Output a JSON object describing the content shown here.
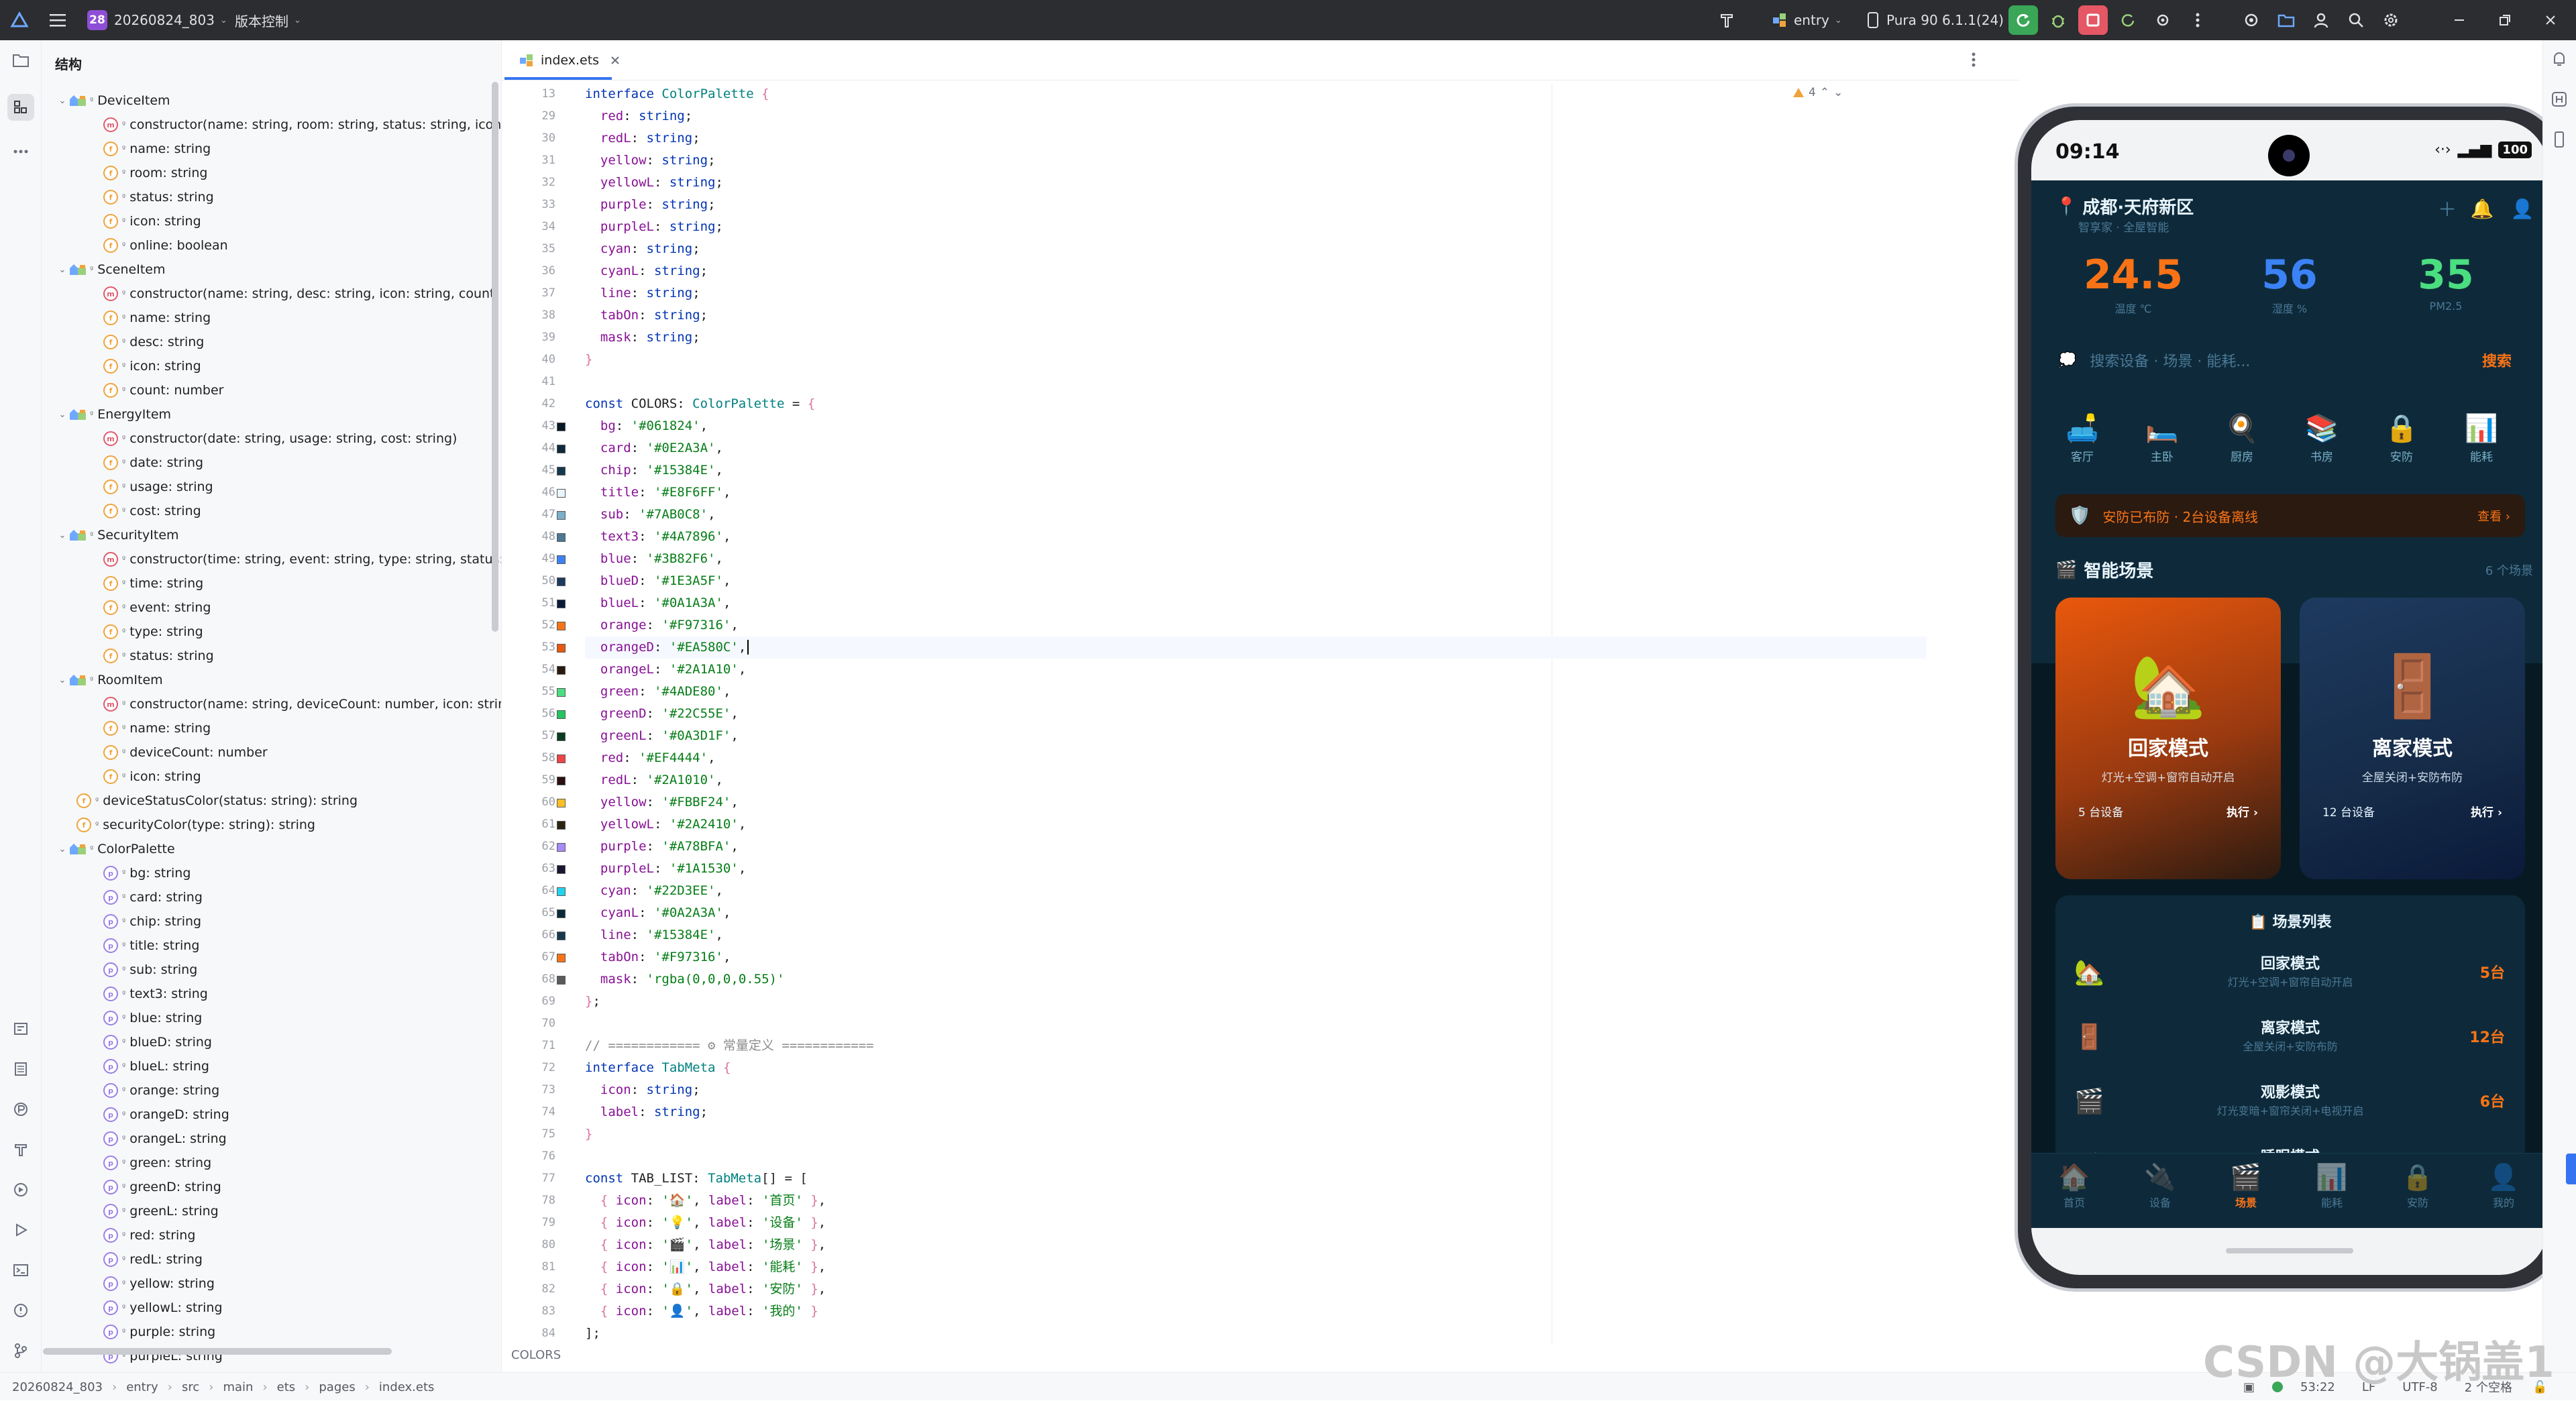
{
  "titlebar": {
    "project_badge": "28",
    "project_name": "20260824_803",
    "vcs": "版本控制",
    "run_config": "entry",
    "device": "Pura 90 6.1.1(24)"
  },
  "structure": {
    "title": "结构",
    "items": [
      {
        "kind": "class",
        "label": "DeviceItem",
        "indent": 0
      },
      {
        "kind": "method",
        "label": "constructor(name: string, room: string, status: string, icon: string, online: boolean)",
        "indent": 1
      },
      {
        "kind": "field",
        "label": "name: string",
        "indent": 1
      },
      {
        "kind": "field",
        "label": "room: string",
        "indent": 1
      },
      {
        "kind": "field",
        "label": "status: string",
        "indent": 1
      },
      {
        "kind": "field",
        "label": "icon: string",
        "indent": 1
      },
      {
        "kind": "field",
        "label": "online: boolean",
        "indent": 1
      },
      {
        "kind": "class",
        "label": "SceneItem",
        "indent": 0
      },
      {
        "kind": "method",
        "label": "constructor(name: string, desc: string, icon: string, count: number)",
        "indent": 1
      },
      {
        "kind": "field",
        "label": "name: string",
        "indent": 1
      },
      {
        "kind": "field",
        "label": "desc: string",
        "indent": 1
      },
      {
        "kind": "field",
        "label": "icon: string",
        "indent": 1
      },
      {
        "kind": "field",
        "label": "count: number",
        "indent": 1
      },
      {
        "kind": "class",
        "label": "EnergyItem",
        "indent": 0
      },
      {
        "kind": "method",
        "label": "constructor(date: string, usage: string, cost: string)",
        "indent": 1
      },
      {
        "kind": "field",
        "label": "date: string",
        "indent": 1
      },
      {
        "kind": "field",
        "label": "usage: string",
        "indent": 1
      },
      {
        "kind": "field",
        "label": "cost: string",
        "indent": 1
      },
      {
        "kind": "class",
        "label": "SecurityItem",
        "indent": 0
      },
      {
        "kind": "method",
        "label": "constructor(time: string, event: string, type: string, status: string)",
        "indent": 1
      },
      {
        "kind": "field",
        "label": "time: string",
        "indent": 1
      },
      {
        "kind": "field",
        "label": "event: string",
        "indent": 1
      },
      {
        "kind": "field",
        "label": "type: string",
        "indent": 1
      },
      {
        "kind": "field",
        "label": "status: string",
        "indent": 1
      },
      {
        "kind": "class",
        "label": "RoomItem",
        "indent": 0
      },
      {
        "kind": "method",
        "label": "constructor(name: string, deviceCount: number, icon: string)",
        "indent": 1
      },
      {
        "kind": "field",
        "label": "name: string",
        "indent": 1
      },
      {
        "kind": "field",
        "label": "deviceCount: number",
        "indent": 1
      },
      {
        "kind": "field",
        "label": "icon: string",
        "indent": 1
      },
      {
        "kind": "func",
        "label": "deviceStatusColor(status: string): string",
        "indent": 0
      },
      {
        "kind": "func",
        "label": "securityColor(type: string): string",
        "indent": 0
      },
      {
        "kind": "iface",
        "label": "ColorPalette",
        "indent": 0
      },
      {
        "kind": "prop",
        "label": "bg: string",
        "indent": 1
      },
      {
        "kind": "prop",
        "label": "card: string",
        "indent": 1
      },
      {
        "kind": "prop",
        "label": "chip: string",
        "indent": 1
      },
      {
        "kind": "prop",
        "label": "title: string",
        "indent": 1
      },
      {
        "kind": "prop",
        "label": "sub: string",
        "indent": 1
      },
      {
        "kind": "prop",
        "label": "text3: string",
        "indent": 1
      },
      {
        "kind": "prop",
        "label": "blue: string",
        "indent": 1
      },
      {
        "kind": "prop",
        "label": "blueD: string",
        "indent": 1
      },
      {
        "kind": "prop",
        "label": "blueL: string",
        "indent": 1
      },
      {
        "kind": "prop",
        "label": "orange: string",
        "indent": 1
      },
      {
        "kind": "prop",
        "label": "orangeD: string",
        "indent": 1
      },
      {
        "kind": "prop",
        "label": "orangeL: string",
        "indent": 1
      },
      {
        "kind": "prop",
        "label": "green: string",
        "indent": 1
      },
      {
        "kind": "prop",
        "label": "greenD: string",
        "indent": 1
      },
      {
        "kind": "prop",
        "label": "greenL: string",
        "indent": 1
      },
      {
        "kind": "prop",
        "label": "red: string",
        "indent": 1
      },
      {
        "kind": "prop",
        "label": "redL: string",
        "indent": 1
      },
      {
        "kind": "prop",
        "label": "yellow: string",
        "indent": 1
      },
      {
        "kind": "prop",
        "label": "yellowL: string",
        "indent": 1
      },
      {
        "kind": "prop",
        "label": "purple: string",
        "indent": 1
      },
      {
        "kind": "prop",
        "label": "purpleL: string",
        "indent": 1
      }
    ]
  },
  "editor": {
    "tab_name": "index.ets",
    "warning_count": "4",
    "context_label": "COLORS",
    "lines": [
      {
        "n": "13",
        "html": "<span class='kw'>interface</span> <span class='ty'>ColorPalette</span> <span class='br'>{</span>",
        "sw": ""
      },
      {
        "n": "29",
        "html": "  <span class='pr'>red</span>: <span class='kw'>string</span>;",
        "sw": ""
      },
      {
        "n": "30",
        "html": "  <span class='pr'>redL</span>: <span class='kw'>string</span>;",
        "sw": ""
      },
      {
        "n": "31",
        "html": "  <span class='pr'>yellow</span>: <span class='kw'>string</span>;",
        "sw": ""
      },
      {
        "n": "32",
        "html": "  <span class='pr'>yellowL</span>: <span class='kw'>string</span>;",
        "sw": ""
      },
      {
        "n": "33",
        "html": "  <span class='pr'>purple</span>: <span class='kw'>string</span>;",
        "sw": ""
      },
      {
        "n": "34",
        "html": "  <span class='pr'>purpleL</span>: <span class='kw'>string</span>;",
        "sw": ""
      },
      {
        "n": "35",
        "html": "  <span class='pr'>cyan</span>: <span class='kw'>string</span>;",
        "sw": ""
      },
      {
        "n": "36",
        "html": "  <span class='pr'>cyanL</span>: <span class='kw'>string</span>;",
        "sw": ""
      },
      {
        "n": "37",
        "html": "  <span class='pr'>line</span>: <span class='kw'>string</span>;",
        "sw": ""
      },
      {
        "n": "38",
        "html": "  <span class='pr'>tabOn</span>: <span class='kw'>string</span>;",
        "sw": ""
      },
      {
        "n": "39",
        "html": "  <span class='pr'>mask</span>: <span class='kw'>string</span>;",
        "sw": ""
      },
      {
        "n": "40",
        "html": "<span class='br'>}</span>",
        "sw": ""
      },
      {
        "n": "41",
        "html": "",
        "sw": ""
      },
      {
        "n": "42",
        "html": "<span class='kw'>const</span> COLORS: <span class='ty'>ColorPalette</span> = <span class='br'>{</span>",
        "sw": ""
      },
      {
        "n": "43",
        "html": "  <span class='pr'>bg</span>: <span class='st'>'#061824'</span>,",
        "sw": "#061824"
      },
      {
        "n": "44",
        "html": "  <span class='pr'>card</span>: <span class='st'>'#0E2A3A'</span>,",
        "sw": "#0E2A3A"
      },
      {
        "n": "45",
        "html": "  <span class='pr'>chip</span>: <span class='st'>'#15384E'</span>,",
        "sw": "#15384E"
      },
      {
        "n": "46",
        "html": "  <span class='pr'>title</span>: <span class='st'>'#E8F6FF'</span>,",
        "sw": "#E8F6FF"
      },
      {
        "n": "47",
        "html": "  <span class='pr'>sub</span>: <span class='st'>'#7AB0C8'</span>,",
        "sw": "#7AB0C8"
      },
      {
        "n": "48",
        "html": "  <span class='pr'>text3</span>: <span class='st'>'#4A7896'</span>,",
        "sw": "#4A7896"
      },
      {
        "n": "49",
        "html": "  <span class='pr'>blue</span>: <span class='st'>'#3B82F6'</span>,",
        "sw": "#3B82F6"
      },
      {
        "n": "50",
        "html": "  <span class='pr'>blueD</span>: <span class='st'>'#1E3A5F'</span>,",
        "sw": "#1E3A5F"
      },
      {
        "n": "51",
        "html": "  <span class='pr'>blueL</span>: <span class='st'>'#0A1A3A'</span>,",
        "sw": "#0A1A3A"
      },
      {
        "n": "52",
        "html": "  <span class='pr'>orange</span>: <span class='st'>'#F97316'</span>,",
        "sw": "#F97316"
      },
      {
        "n": "53",
        "html": "  <span class='pr'>orangeD</span>: <span class='st'>'#EA580C'</span>,",
        "sw": "#EA580C",
        "cur": true
      },
      {
        "n": "54",
        "html": "  <span class='pr'>orangeL</span>: <span class='st'>'#2A1A10'</span>,",
        "sw": "#2A1A10"
      },
      {
        "n": "55",
        "html": "  <span class='pr'>green</span>: <span class='st'>'#4ADE80'</span>,",
        "sw": "#4ADE80"
      },
      {
        "n": "56",
        "html": "  <span class='pr'>greenD</span>: <span class='st'>'#22C55E'</span>,",
        "sw": "#22C55E"
      },
      {
        "n": "57",
        "html": "  <span class='pr'>greenL</span>: <span class='st'>'#0A3D1F'</span>,",
        "sw": "#0A3D1F"
      },
      {
        "n": "58",
        "html": "  <span class='pr'>red</span>: <span class='st'>'#EF4444'</span>,",
        "sw": "#EF4444"
      },
      {
        "n": "59",
        "html": "  <span class='pr'>redL</span>: <span class='st'>'#2A1010'</span>,",
        "sw": "#2A1010"
      },
      {
        "n": "60",
        "html": "  <span class='pr'>yellow</span>: <span class='st'>'#FBBF24'</span>,",
        "sw": "#FBBF24"
      },
      {
        "n": "61",
        "html": "  <span class='pr'>yellowL</span>: <span class='st'>'#2A2410'</span>,",
        "sw": "#2A2410"
      },
      {
        "n": "62",
        "html": "  <span class='pr'>purple</span>: <span class='st'>'#A78BFA'</span>,",
        "sw": "#A78BFA"
      },
      {
        "n": "63",
        "html": "  <span class='pr'>purpleL</span>: <span class='st'>'#1A1530'</span>,",
        "sw": "#1A1530"
      },
      {
        "n": "64",
        "html": "  <span class='pr'>cyan</span>: <span class='st'>'#22D3EE'</span>,",
        "sw": "#22D3EE"
      },
      {
        "n": "65",
        "html": "  <span class='pr'>cyanL</span>: <span class='st'>'#0A2A3A'</span>,",
        "sw": "#0A2A3A"
      },
      {
        "n": "66",
        "html": "  <span class='pr'>line</span>: <span class='st'>'#15384E'</span>,",
        "sw": "#15384E"
      },
      {
        "n": "67",
        "html": "  <span class='pr'>tabOn</span>: <span class='st'>'#F97316'</span>,",
        "sw": "#F97316"
      },
      {
        "n": "68",
        "html": "  <span class='pr'>mask</span>: <span class='st'>'rgba(0,0,0,0.55)'</span>",
        "sw": "#5A5A5A"
      },
      {
        "n": "69",
        "html": "<span class='br'>}</span>;",
        "sw": ""
      },
      {
        "n": "70",
        "html": "",
        "sw": ""
      },
      {
        "n": "71",
        "html": "<span class='cm'>// ============ ⚙ 常量定义 ============</span>",
        "sw": ""
      },
      {
        "n": "72",
        "html": "<span class='kw'>interface</span> <span class='ty'>TabMeta</span> <span class='br'>{</span>",
        "sw": ""
      },
      {
        "n": "73",
        "html": "  <span class='pr'>icon</span>: <span class='kw'>string</span>;",
        "sw": ""
      },
      {
        "n": "74",
        "html": "  <span class='pr'>label</span>: <span class='kw'>string</span>;",
        "sw": ""
      },
      {
        "n": "75",
        "html": "<span class='br'>}</span>",
        "sw": ""
      },
      {
        "n": "76",
        "html": "",
        "sw": ""
      },
      {
        "n": "77",
        "html": "<span class='kw'>const</span> TAB_LIST: <span class='ty'>TabMeta</span>[] = [",
        "sw": ""
      },
      {
        "n": "78",
        "html": "  <span class='br'>{</span> <span class='pr'>icon</span>: <span class='st'>'🏠'</span>, <span class='pr'>label</span>: <span class='st'>'首页'</span> <span class='br'>}</span>,",
        "sw": ""
      },
      {
        "n": "79",
        "html": "  <span class='br'>{</span> <span class='pr'>icon</span>: <span class='st'>'💡'</span>, <span class='pr'>label</span>: <span class='st'>'设备'</span> <span class='br'>}</span>,",
        "sw": ""
      },
      {
        "n": "80",
        "html": "  <span class='br'>{</span> <span class='pr'>icon</span>: <span class='st'>'🎬'</span>, <span class='pr'>label</span>: <span class='st'>'场景'</span> <span class='br'>}</span>,",
        "sw": ""
      },
      {
        "n": "81",
        "html": "  <span class='br'>{</span> <span class='pr'>icon</span>: <span class='st'>'📊'</span>, <span class='pr'>label</span>: <span class='st'>'能耗'</span> <span class='br'>}</span>,",
        "sw": ""
      },
      {
        "n": "82",
        "html": "  <span class='br'>{</span> <span class='pr'>icon</span>: <span class='st'>'🔒'</span>, <span class='pr'>label</span>: <span class='st'>'安防'</span> <span class='br'>}</span>,",
        "sw": ""
      },
      {
        "n": "83",
        "html": "  <span class='br'>{</span> <span class='pr'>icon</span>: <span class='st'>'👤'</span>, <span class='pr'>label</span>: <span class='st'>'我的'</span> <span class='br'>}</span>",
        "sw": ""
      },
      {
        "n": "84",
        "html": "];",
        "sw": ""
      }
    ]
  },
  "statusbar": {
    "crumbs": [
      "20260824_803",
      "entry",
      "src",
      "main",
      "ets",
      "pages",
      "index.ets"
    ],
    "position": "53:22",
    "line_sep": "LF",
    "encoding": "UTF-8",
    "indent": "2 个空格"
  },
  "phone": {
    "time": "09:14",
    "battery": "100",
    "location": "成都·天府新区",
    "location_sub": "智享家 · 全屋智能",
    "stats": [
      {
        "value": "24.5",
        "label": "温度 ℃",
        "color": "#F97316"
      },
      {
        "value": "56",
        "label": "湿度 %",
        "color": "#3B82F6"
      },
      {
        "value": "35",
        "label": "PM2.5",
        "color": "#4ADE80"
      }
    ],
    "search_placeholder": "搜索设备 · 场景 · 能耗...",
    "search_button": "搜索",
    "rooms": [
      {
        "icon": "🛋️",
        "label": "客厅"
      },
      {
        "icon": "🛏️",
        "label": "主卧"
      },
      {
        "icon": "🍳",
        "label": "厨房"
      },
      {
        "icon": "📚",
        "label": "书房"
      },
      {
        "icon": "🔒",
        "label": "安防"
      },
      {
        "icon": "📊",
        "label": "能耗"
      }
    ],
    "alert_text": "安防已布防 · 2台设备离线",
    "alert_more": "查看 ›",
    "section_title": "智能场景",
    "section_count": "6 个场景",
    "cards": [
      {
        "icon": "🏡",
        "title": "回家模式",
        "desc": "灯光+空调+窗帘自动开启",
        "count": "5 台设备",
        "action": "执行 ›"
      },
      {
        "icon": "🚪",
        "title": "离家模式",
        "desc": "全屋关闭+安防布防",
        "count": "12 台设备",
        "action": "执行 ›"
      }
    ],
    "list_title": "📋 场景列表",
    "list": [
      {
        "icon": "🏡",
        "title": "回家模式",
        "desc": "灯光+空调+窗帘自动开启",
        "count": "5台"
      },
      {
        "icon": "🚪",
        "title": "离家模式",
        "desc": "全屋关闭+安防布防",
        "count": "12台"
      },
      {
        "icon": "🎬",
        "title": "观影模式",
        "desc": "灯光变暗+窗帘关闭+电视开启",
        "count": "6台"
      },
      {
        "icon": "🌙",
        "title": "睡眠模式",
        "desc": "",
        "count": ""
      }
    ],
    "tabs": [
      {
        "icon": "🏠",
        "label": "首页"
      },
      {
        "icon": "🔌",
        "label": "设备"
      },
      {
        "icon": "🎬",
        "label": "场景"
      },
      {
        "icon": "📊",
        "label": "能耗"
      },
      {
        "icon": "🔒",
        "label": "安防"
      },
      {
        "icon": "👤",
        "label": "我的"
      }
    ],
    "active_tab": 2
  },
  "watermark": "CSDN @大锅盖1"
}
